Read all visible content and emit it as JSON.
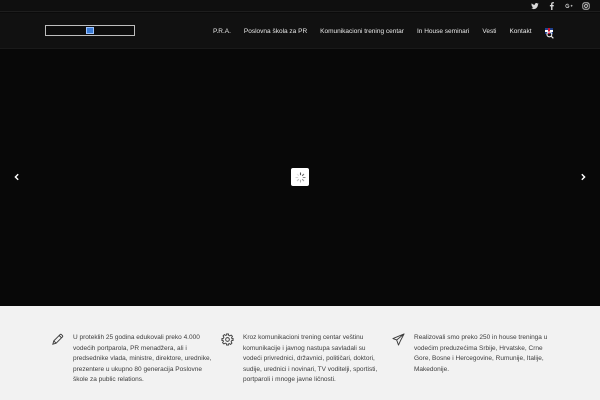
{
  "topbar": {
    "social": [
      {
        "name": "twitter-icon",
        "glyph": "t"
      },
      {
        "name": "facebook-icon",
        "glyph": "f"
      },
      {
        "name": "google-plus-icon",
        "glyph": "G+"
      },
      {
        "name": "instagram-icon",
        "glyph": "◎"
      }
    ]
  },
  "header": {
    "nav": [
      {
        "label": "P.R.A."
      },
      {
        "label": "Poslovna škola za PR"
      },
      {
        "label": "Komunikacioni trening centar"
      },
      {
        "label": "In House seminari"
      },
      {
        "label": "Vesti"
      },
      {
        "label": "Kontakt"
      }
    ],
    "language_flag": "uk-flag-icon"
  },
  "hero": {
    "background": "#080808",
    "loading": true
  },
  "features": [
    {
      "icon": "pencil-icon",
      "text": "U proteklih 25 godina edukovali preko 4.000 vodećih portparola, PR menadžera, ali i predsednike vlada, ministre, direktore, urednike, prezentere u ukupno 80 generacija Poslovne škole za public relations."
    },
    {
      "icon": "gear-icon",
      "text": "Kroz komunikacioni trening centar veštinu komunikacije i javnog nastupa savladali su vodeći privrednici, državnici, političari, doktori, sudije, urednici i novinari, TV voditelji, sportisti, portparoli i mnoge javne ličnosti."
    },
    {
      "icon": "paper-plane-icon",
      "text": "Realizovali smo preko 250 in house treninga u vodećim preduzećima Srbije, Hrvatske, Crne Gore, Bosne i Hercegovine, Rumunije, Italije, Makedonije."
    }
  ],
  "colors": {
    "header_bg": "#111111",
    "features_bg": "#f2f2f2",
    "nav_text": "#e8e8e8",
    "body_text": "#3c3c3c"
  }
}
